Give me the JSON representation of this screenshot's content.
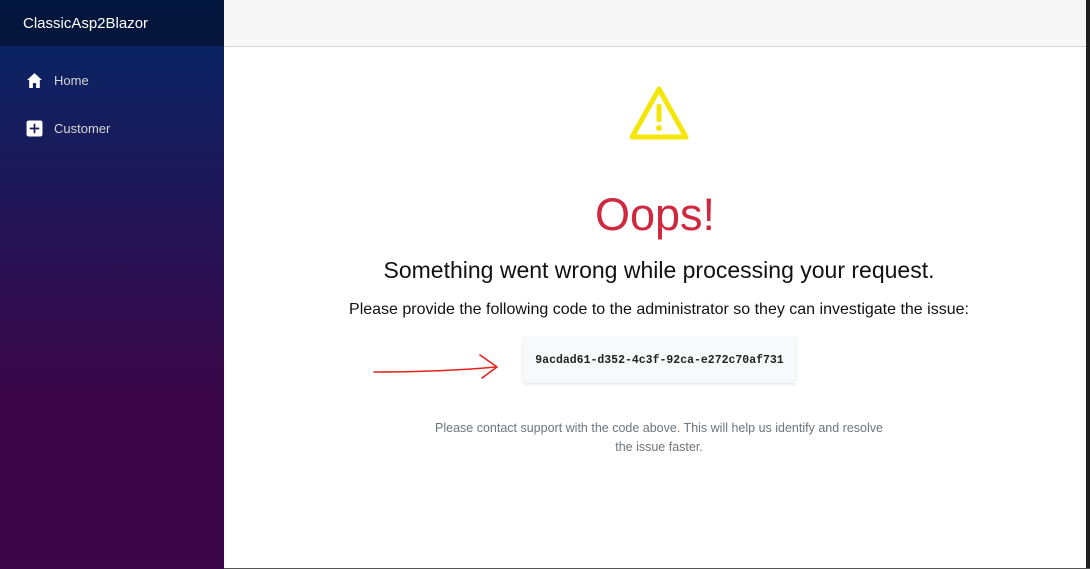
{
  "app": {
    "brand": "ClassicAsp2Blazor"
  },
  "sidebar": {
    "items": [
      {
        "label": "Home",
        "icon": "home-icon"
      },
      {
        "label": "Customer",
        "icon": "plus-square-icon"
      }
    ]
  },
  "error": {
    "title": "Oops!",
    "message": "Something went wrong while processing your request.",
    "instruction": "Please provide the following code to the administrator so they can investigate the issue:",
    "code": "9acdad61-d352-4c3f-92ca-e272c70af731",
    "support": "Please contact support with the code above. This will help us identify and resolve the issue faster."
  },
  "colors": {
    "warning": "#f5e60a",
    "title": "#d0283f",
    "annotation_arrow": "#e8201c"
  }
}
